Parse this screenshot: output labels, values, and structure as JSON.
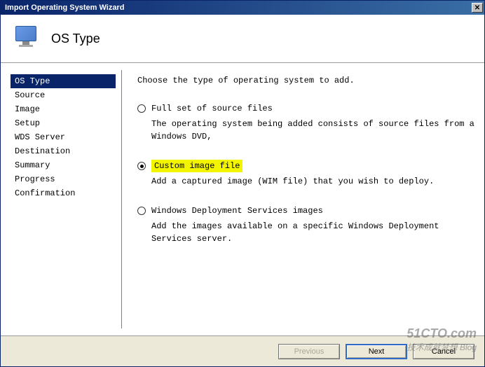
{
  "titlebar": {
    "title": "Import Operating System Wizard",
    "close": "✕"
  },
  "header": {
    "title": "OS Type"
  },
  "sidebar": {
    "items": [
      {
        "label": "OS Type",
        "selected": true
      },
      {
        "label": "Source",
        "selected": false
      },
      {
        "label": "Image",
        "selected": false
      },
      {
        "label": "Setup",
        "selected": false
      },
      {
        "label": "WDS Server",
        "selected": false
      },
      {
        "label": "Destination",
        "selected": false
      },
      {
        "label": "Summary",
        "selected": false
      },
      {
        "label": "Progress",
        "selected": false
      },
      {
        "label": "Confirmation",
        "selected": false
      }
    ]
  },
  "content": {
    "prompt": "Choose the type of operating system to add.",
    "options": [
      {
        "label": "Full set of source files",
        "desc": "The operating system being added consists of source files from a Windows DVD,",
        "checked": false,
        "highlighted": false
      },
      {
        "label": "Custom image file",
        "desc": "Add a captured image (WIM file) that you wish to deploy.",
        "checked": true,
        "highlighted": true
      },
      {
        "label": "Windows Deployment Services images",
        "desc": "Add the images available on a specific Windows Deployment Services server.",
        "checked": false,
        "highlighted": false
      }
    ]
  },
  "footer": {
    "previous": "Previous",
    "next": "Next",
    "cancel": "Cancel"
  },
  "watermark": {
    "main": "51CTO.com",
    "sub": "技术成就梦想 Blog"
  }
}
